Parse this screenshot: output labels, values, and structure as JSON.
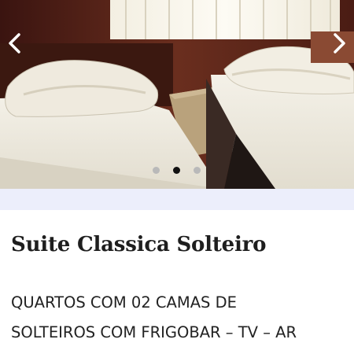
{
  "carousel": {
    "prev_icon": "chevron-left-icon",
    "next_icon": "chevron-right-icon",
    "slide_count": 3,
    "active_slide": 2
  },
  "colors": {
    "accent_strip": "#eceefb",
    "dot_active": "#111111",
    "dot_inactive": "#b9b9b9"
  },
  "room": {
    "title": "Suite Classica Solteiro",
    "description_lines": [
      "QUARTOS COM 02 CAMAS DE",
      "SOLTEIROS COM FRIGOBAR – TV – AR"
    ]
  }
}
